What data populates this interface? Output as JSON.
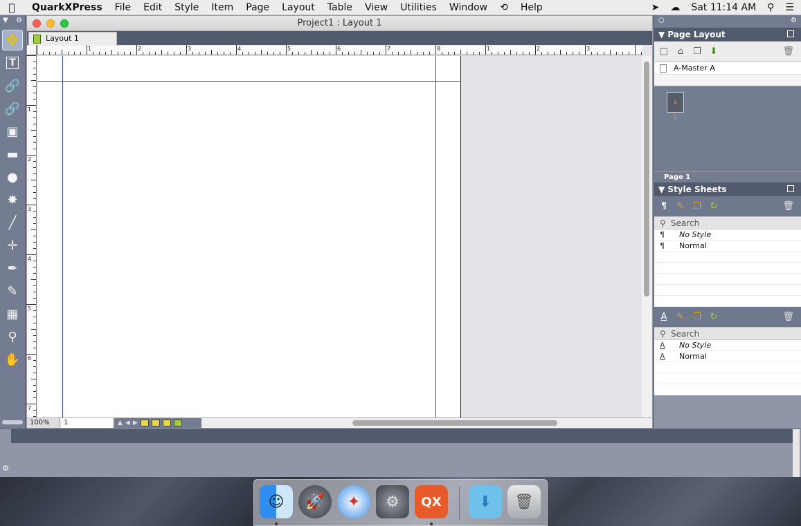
{
  "menubar": {
    "app_name": "QuarkXPress",
    "items": [
      "File",
      "Edit",
      "Style",
      "Item",
      "Page",
      "Layout",
      "Table",
      "View",
      "Utilities",
      "Window",
      "Help"
    ],
    "clock": "Sat 11:14 AM"
  },
  "document": {
    "title": "Project1 : Layout 1",
    "tab_label": "Layout 1",
    "zoom": "100%",
    "page_field": "1"
  },
  "rulers": {
    "horizontal": [
      "1",
      "2",
      "3",
      "4",
      "5",
      "6",
      "7",
      "8",
      "1",
      "2",
      "3"
    ],
    "vertical": [
      "1",
      "2",
      "3",
      "4",
      "5",
      "6",
      "7"
    ]
  },
  "page_layout": {
    "title": "Page Layout",
    "master_label": "A-Master A",
    "page_thumb_label": "A",
    "page_thumb_number": "1",
    "page_label": "Page 1"
  },
  "style_sheets": {
    "title": "Style Sheets",
    "search_placeholder": "Search",
    "paragraph_styles": [
      "No Style",
      "Normal"
    ],
    "character_styles": [
      "No Style",
      "Normal"
    ]
  },
  "colors": {
    "palette_bg": "#737c90",
    "guide": "#3949b0",
    "active_tool": "#a7b2c9"
  }
}
